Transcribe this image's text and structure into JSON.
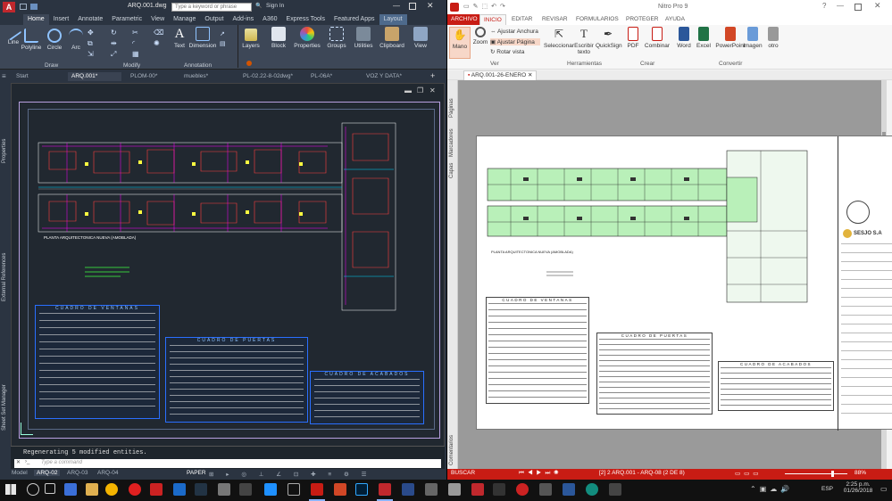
{
  "acad": {
    "file_title": "ARQ.001.dwg",
    "search_placeholder": "Type a keyword or phrase",
    "sign_in": "Sign In",
    "ribbon_tabs": [
      "Home",
      "Insert",
      "Annotate",
      "Parametric",
      "View",
      "Manage",
      "Output",
      "Add-ins",
      "A360",
      "Express Tools",
      "Featured Apps",
      "Layout"
    ],
    "tools": [
      "Line",
      "Polyline",
      "Circle",
      "Arc",
      "Text",
      "Dimension",
      "Layers",
      "Block",
      "Properties",
      "Groups",
      "Utilities",
      "Clipboard",
      "View"
    ],
    "panels": [
      "Draw",
      "Modify",
      "Annotation"
    ],
    "file_tabs": [
      "Start",
      "ARQ.001*",
      "PLOM-00*",
      "muebles*",
      "PL-02.22-8-02dwg*",
      "PL-06A*",
      "VOZ Y DATA*"
    ],
    "side_labels": [
      "Properties",
      "External References",
      "Sheet Set Manager"
    ],
    "drawing_title": "PLANTA ARQUITECTONICA NUEVA (AMOBLADA)",
    "table_titles": [
      "CUADRO DE VENTANAS",
      "CUADRO DE PUERTAS",
      "CUADRO DE ACABADOS"
    ],
    "command_output": "Regenerating 5 modified entities.",
    "command_placeholder": "Type a command",
    "layout_tabs": [
      "Model",
      "ARQ-02",
      "ARQ-03",
      "ARQ-04"
    ],
    "paper_label": "PAPER"
  },
  "nitro": {
    "title": "Nitro Pro 9",
    "tabs": [
      "ARCHIVO",
      "INICIO",
      "EDITAR",
      "REVISAR",
      "FORMULARIOS",
      "PROTEGER",
      "AYUDA"
    ],
    "buttons": {
      "mano": "Mano",
      "zoom": "Zoom",
      "ajustar_anchura": "Ajustar Anchura",
      "ajustar_pagina": "Ajustar Página",
      "rotar_vista": "Rotar vista",
      "seleccionar": "Seleccionar",
      "escribir_texto": "Escribir texto",
      "quicksign": "QuickSign",
      "pdf": "PDF",
      "combinar": "Combinar",
      "word": "Word",
      "excel": "Excel",
      "powerpoint": "PowerPoint",
      "imagen": "imagen",
      "otro": "otro"
    },
    "groups": [
      "Ver",
      "Herramientas",
      "Crear",
      "Convertir"
    ],
    "doc_tab": "ARQ.001-26-ENERO",
    "side_labels": [
      "Páginas",
      "Marcadores",
      "Capas",
      "Comentarios"
    ],
    "drawing_title": "PLANTA ARQUITECTONICA NUEVA (AMOBLADA)",
    "table_titles": [
      "CUADRO DE VENTANAS",
      "CUADRO DE PUERTAS",
      "CUADRO DE ACABADOS"
    ],
    "stamp": "SESJO S.A",
    "search": "BUSCAR",
    "page_info": "[2] 2 ARQ.001 - ARQ-08 (2 DE 8)",
    "zoom": "88%"
  },
  "taskbar": {
    "time": "2:25 p.m.",
    "date": "01/26/2018",
    "lang": "ESP"
  },
  "colors": {
    "acad_bg": "#2b3441",
    "nitro_red": "#c81c14",
    "plan_green": "#b9f0b9"
  }
}
